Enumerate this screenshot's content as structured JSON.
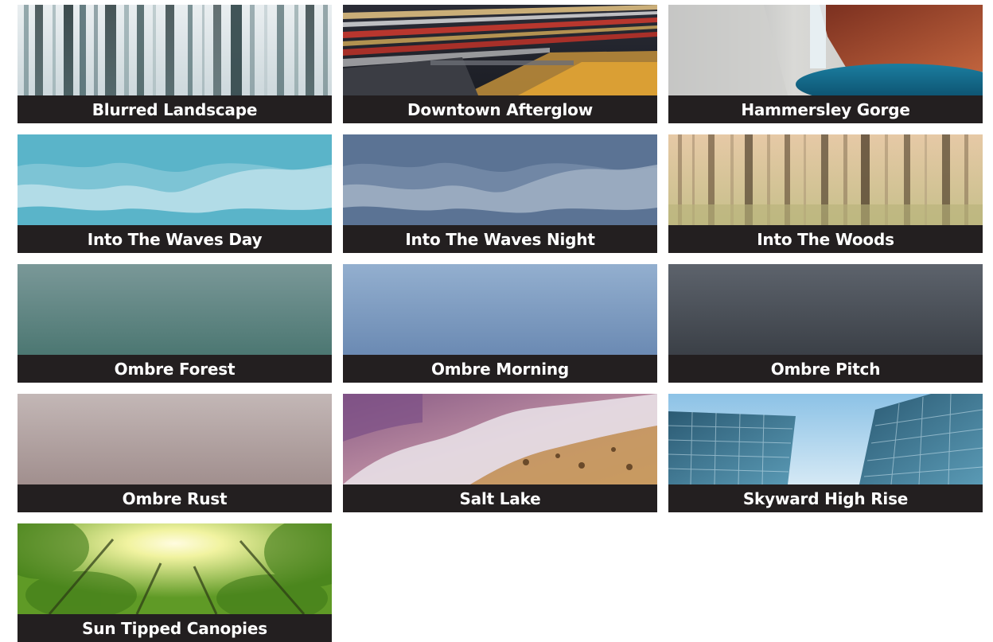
{
  "gallery": {
    "items": [
      {
        "label": "Blurred Landscape",
        "image": "blurred-forest-photo"
      },
      {
        "label": "Downtown Afterglow",
        "image": "highway-light-trails-photo"
      },
      {
        "label": "Hammersley Gorge",
        "image": "gorge-waterfall-photo"
      },
      {
        "label": "Into The Waves Day",
        "image": "teal-mountain-waves-art"
      },
      {
        "label": "Into The Waves Night",
        "image": "slate-mountain-waves-art"
      },
      {
        "label": "Into The Woods",
        "image": "misty-woods-photo"
      },
      {
        "label": "Ombre Forest",
        "image": "ombre-gradient",
        "colors": [
          "#7a9898",
          "#4c7772"
        ]
      },
      {
        "label": "Ombre Morning",
        "image": "ombre-gradient",
        "colors": [
          "#93afcf",
          "#6b8ab3"
        ]
      },
      {
        "label": "Ombre Pitch",
        "image": "ombre-gradient",
        "colors": [
          "#5d636c",
          "#3b4047"
        ]
      },
      {
        "label": "Ombre Rust",
        "image": "ombre-gradient",
        "colors": [
          "#c3b7b6",
          "#a18f8e"
        ]
      },
      {
        "label": "Salt Lake",
        "image": "salt-lake-aerial-photo"
      },
      {
        "label": "Skyward High Rise",
        "image": "glass-towers-sky-photo"
      },
      {
        "label": "Sun Tipped Canopies",
        "image": "sunlit-canopy-photo"
      }
    ]
  },
  "colors": {
    "label_bar": "#231f20",
    "label_text": "#ffffff"
  }
}
